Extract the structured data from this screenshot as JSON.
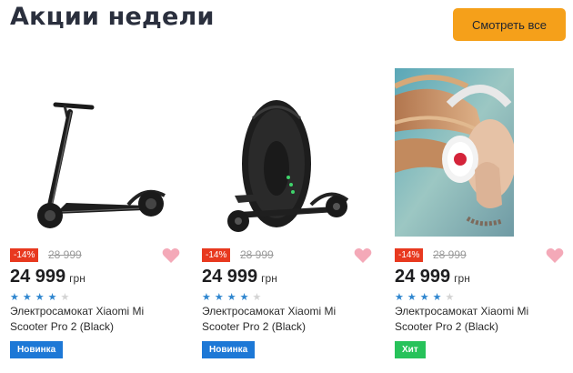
{
  "header": {
    "title": "Акции недели",
    "see_all_label": "Смотреть все"
  },
  "colors": {
    "accent_orange": "#f5a01a",
    "discount_red": "#e8391f",
    "star_blue": "#2f86cf",
    "badge_new": "#1d78d6",
    "badge_hit": "#27c25a",
    "heart_pink": "#f4a9b8"
  },
  "products": [
    {
      "image": "electric-scooter",
      "discount": "-14%",
      "old_price": "28 999",
      "price": "24 999",
      "currency": "грн",
      "rating": 4,
      "rating_max": 5,
      "name": "Электросамокат Xiaomi Mi Scooter Pro 2 (Black)",
      "badge": "Новинка",
      "badge_type": "new"
    },
    {
      "image": "monowheel",
      "discount": "-14%",
      "old_price": "28 999",
      "price": "24 999",
      "currency": "грн",
      "rating": 4,
      "rating_max": 5,
      "name": "Электросамокат Xiaomi Mi Scooter Pro 2 (Black)",
      "badge": "Новинка",
      "badge_type": "new"
    },
    {
      "image": "woman-with-headphones",
      "discount": "-14%",
      "old_price": "28 999",
      "price": "24 999",
      "currency": "грн",
      "rating": 4,
      "rating_max": 5,
      "name": "Электросамокат Xiaomi Mi Scooter Pro 2 (Black)",
      "badge": "Хит",
      "badge_type": "hit"
    }
  ]
}
